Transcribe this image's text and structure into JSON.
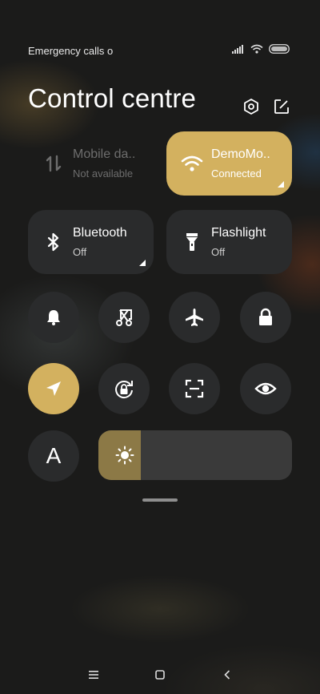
{
  "status_bar": {
    "carrier_text": "Emergency calls o",
    "icons": [
      "signal-icon",
      "wifi-icon",
      "battery-icon"
    ]
  },
  "header": {
    "title": "Control centre",
    "buttons": [
      "settings-icon",
      "edit-icon"
    ]
  },
  "tiles": {
    "mobile_data": {
      "name": "Mobile da..",
      "status": "Not available",
      "icon": "mobile-data-icon",
      "state": "unavailable"
    },
    "wifi": {
      "name": "DemoMo..",
      "status": "Connected",
      "icon": "wifi-icon",
      "state": "on"
    },
    "bluetooth": {
      "name": "Bluetooth",
      "status": "Off",
      "icon": "bluetooth-icon",
      "state": "off"
    },
    "flashlight": {
      "name": "Flashlight",
      "status": "Off",
      "icon": "flashlight-icon",
      "state": "off"
    }
  },
  "toggles": [
    {
      "icon": "bell-icon",
      "state": "off"
    },
    {
      "icon": "screenshot-icon",
      "state": "off"
    },
    {
      "icon": "airplane-icon",
      "state": "off"
    },
    {
      "icon": "lock-icon",
      "state": "off"
    },
    {
      "icon": "location-icon",
      "state": "on"
    },
    {
      "icon": "rotation-lock-icon",
      "state": "off"
    },
    {
      "icon": "scan-icon",
      "state": "off"
    },
    {
      "icon": "eye-icon",
      "state": "off"
    }
  ],
  "auto_brightness": {
    "label": "A"
  },
  "brightness": {
    "level": 0.22
  },
  "colors": {
    "accent": "#d3b15f",
    "tile_bg": "#2a2b2c",
    "slider_fill": "#8c7946"
  },
  "navigation": [
    "menu-icon",
    "home-icon",
    "back-icon"
  ]
}
